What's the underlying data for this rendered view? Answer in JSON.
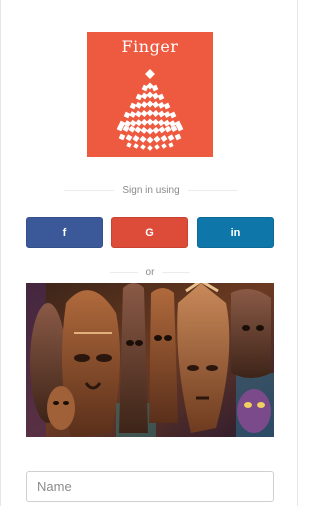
{
  "logo": {
    "text": "Finger",
    "background_color": "#ee5a40",
    "icon": "lotus-diamond-pattern-icon"
  },
  "signin": {
    "label": "Sign in using",
    "buttons": [
      {
        "label": "f",
        "icon": "facebook-icon",
        "color": "#3b5998"
      },
      {
        "label": "G",
        "icon": "google-icon",
        "color": "#dd4b39"
      },
      {
        "label": "in",
        "icon": "linkedin-icon",
        "color": "#0e76a8"
      }
    ]
  },
  "separator": {
    "label": "or"
  },
  "banner": {
    "image": "african-masks-image"
  },
  "form": {
    "name_placeholder": "Name",
    "name_value": ""
  }
}
